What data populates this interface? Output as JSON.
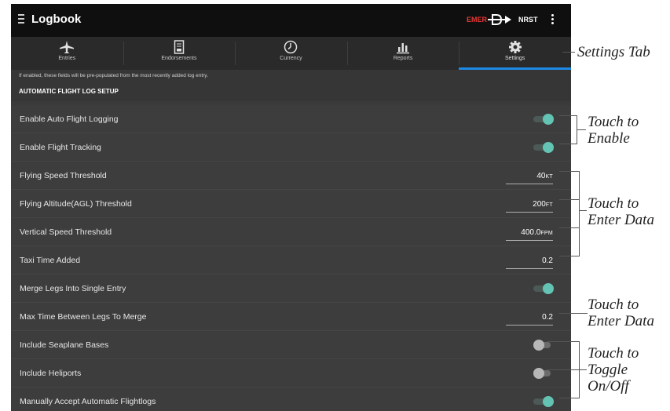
{
  "app": {
    "title": "Logbook",
    "emer_label": "EMER",
    "nrst_label": "NRST",
    "direct_to_icon": "direct-to-icon"
  },
  "tabs": [
    {
      "label": "Entries",
      "icon": "airplane-icon",
      "active": false
    },
    {
      "label": "Endorsements",
      "icon": "document-icon",
      "active": false
    },
    {
      "label": "Currency",
      "icon": "clock-icon",
      "active": false
    },
    {
      "label": "Reports",
      "icon": "bar-chart-icon",
      "active": false
    },
    {
      "label": "Settings",
      "icon": "gear-icon",
      "active": true
    }
  ],
  "info_text": "If enabled, these fields will be pre-populated from the most recently added log entry.",
  "section_header": "AUTOMATIC FLIGHT LOG SETUP",
  "rows": [
    {
      "label": "Enable Auto Flight Logging",
      "type": "toggle",
      "on": true
    },
    {
      "label": "Enable Flight Tracking",
      "type": "toggle",
      "on": true
    },
    {
      "label": "Flying Speed Threshold",
      "type": "value",
      "value": "40",
      "unit": "KT"
    },
    {
      "label": "Flying Altitude(AGL) Threshold",
      "type": "value",
      "value": "200",
      "unit": "FT"
    },
    {
      "label": "Vertical Speed Threshold",
      "type": "value",
      "value": "400.0",
      "unit": "FPM"
    },
    {
      "label": "Taxi Time Added",
      "type": "value",
      "value": "0.2",
      "unit": ""
    },
    {
      "label": "Merge Legs Into Single Entry",
      "type": "toggle",
      "on": true
    },
    {
      "label": "Max Time Between Legs To Merge",
      "type": "value",
      "value": "0.2",
      "unit": ""
    },
    {
      "label": "Include Seaplane Bases",
      "type": "toggle",
      "on": false
    },
    {
      "label": "Include Heliports",
      "type": "toggle",
      "on": false
    },
    {
      "label": "Manually Accept Automatic Flightlogs",
      "type": "toggle",
      "on": true
    }
  ],
  "callouts": {
    "settings_tab": "Settings Tab",
    "touch_enable": [
      "Touch to",
      "Enable"
    ],
    "touch_enter_data_1": [
      "Touch to",
      "Enter Data"
    ],
    "touch_enter_data_2": [
      "Touch to",
      "Enter Data"
    ],
    "touch_toggle": [
      "Touch to",
      "Toggle",
      "On/Off"
    ]
  },
  "colors": {
    "accent_blue": "#1e88e5",
    "toggle_on": "#64c4b4",
    "emer_red": "#e53935"
  }
}
